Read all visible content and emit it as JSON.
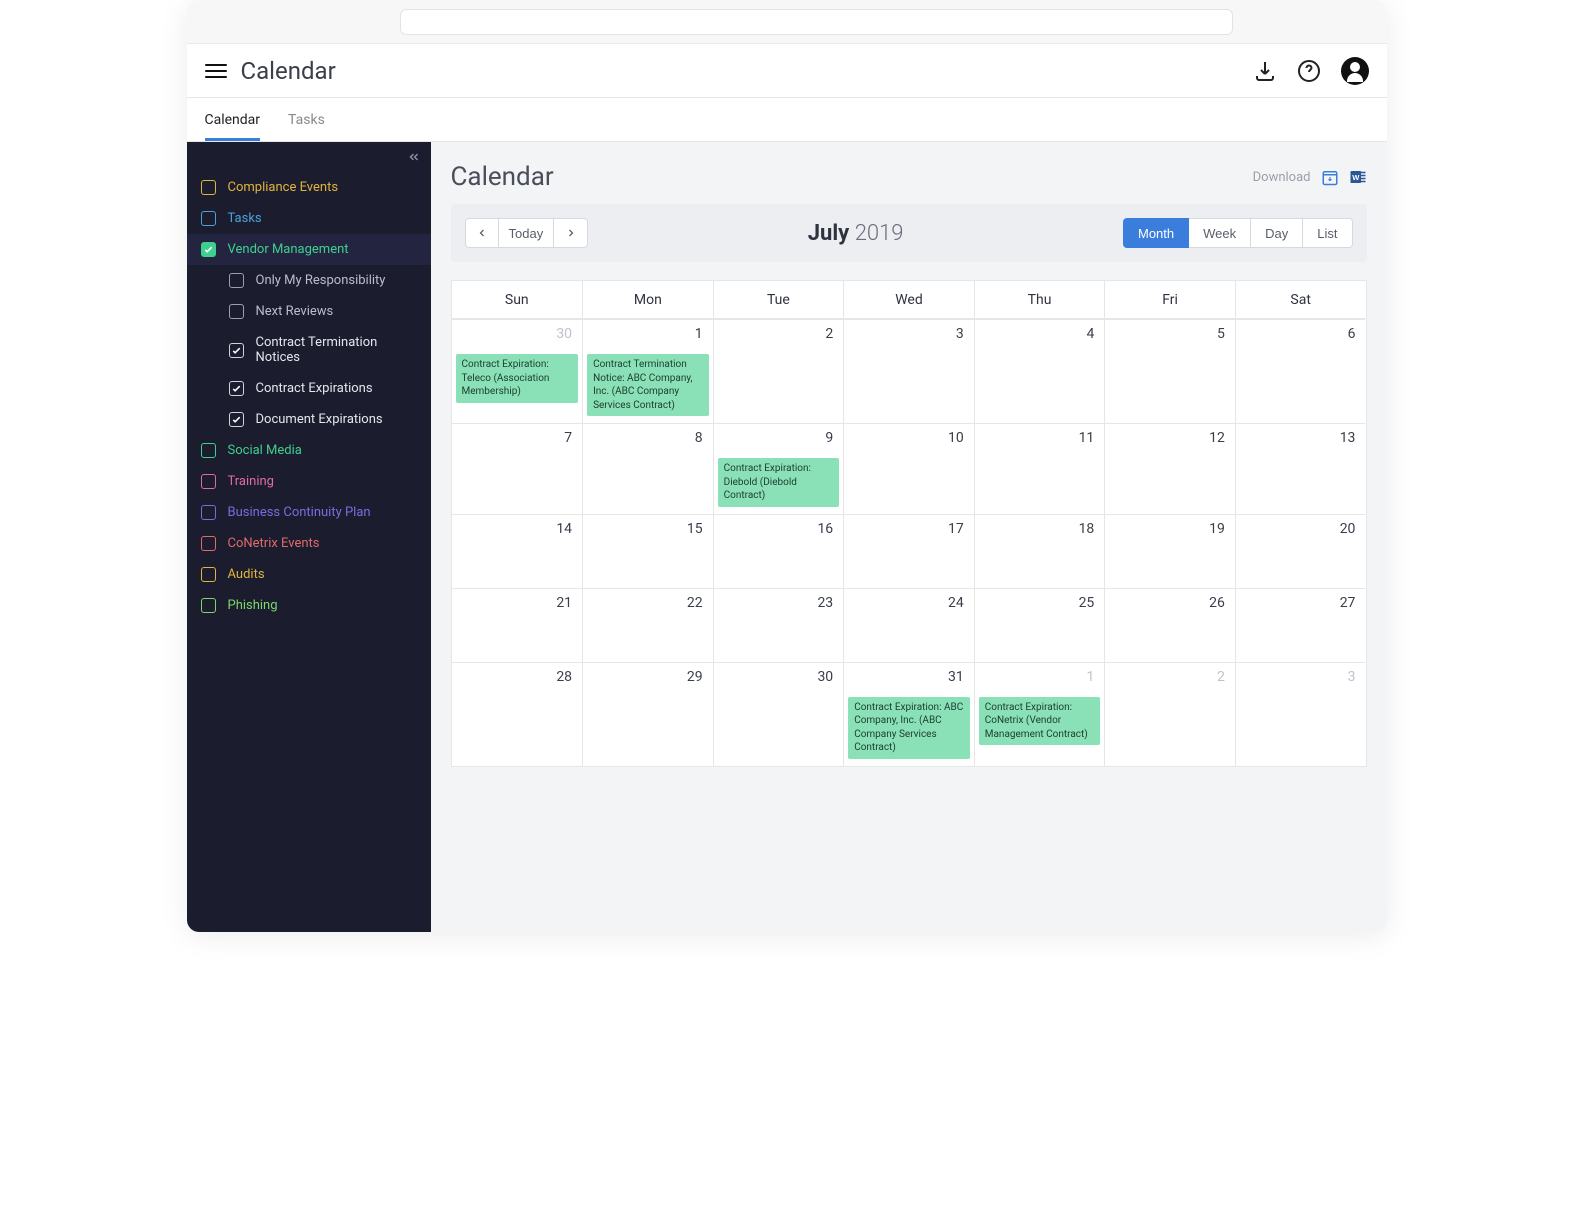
{
  "titlebar": {
    "dot_colors": [
      "#3fb3e5",
      "#3fb3e5",
      "#3fb3e5"
    ]
  },
  "header": {
    "title": "Calendar"
  },
  "tabs": [
    {
      "label": "Calendar",
      "active": true
    },
    {
      "label": "Tasks",
      "active": false
    }
  ],
  "sidebar": {
    "items": [
      {
        "label": "Compliance Events",
        "color": "#e2b33d",
        "checked": false
      },
      {
        "label": "Tasks",
        "color": "#4aa3df",
        "checked": false
      },
      {
        "label": "Vendor Management",
        "color": "#3fcf8e",
        "checked": true,
        "selected": true
      },
      {
        "label": "Only My Responsibility",
        "color": "#9aa0b4",
        "checked": false,
        "sub": true
      },
      {
        "label": "Next Reviews",
        "color": "#9aa0b4",
        "checked": false,
        "sub": true
      },
      {
        "label": "Contract Termination Notices",
        "color": "#cfd3e0",
        "checked": true,
        "sub": true
      },
      {
        "label": "Contract Expirations",
        "color": "#cfd3e0",
        "checked": true,
        "sub": true
      },
      {
        "label": "Document Expirations",
        "color": "#cfd3e0",
        "checked": true,
        "sub": true
      },
      {
        "label": "Social Media",
        "color": "#3fcf8e",
        "checked": false
      },
      {
        "label": "Training",
        "color": "#e06aa8",
        "checked": false
      },
      {
        "label": "Business Continuity Plan",
        "color": "#7a6be0",
        "checked": false
      },
      {
        "label": "CoNetrix Events",
        "color": "#e06a6a",
        "checked": false
      },
      {
        "label": "Audits",
        "color": "#e2b33d",
        "checked": false
      },
      {
        "label": "Phishing",
        "color": "#7fd66a",
        "checked": false
      }
    ]
  },
  "main": {
    "title": "Calendar",
    "download_label": "Download"
  },
  "toolbar": {
    "today_label": "Today",
    "month": "July",
    "year": "2019",
    "views": [
      {
        "label": "Month",
        "active": true
      },
      {
        "label": "Week",
        "active": false
      },
      {
        "label": "Day",
        "active": false
      },
      {
        "label": "List",
        "active": false
      }
    ]
  },
  "calendar": {
    "day_headers": [
      "Sun",
      "Mon",
      "Tue",
      "Wed",
      "Thu",
      "Fri",
      "Sat"
    ],
    "weeks": [
      {
        "days": [
          {
            "num": "30",
            "muted": true,
            "events": [
              "Contract Expiration: Teleco (Association Membership)"
            ]
          },
          {
            "num": "1",
            "events": [
              "Contract Termination Notice: ABC Company, Inc. (ABC Company Services Contract)"
            ]
          },
          {
            "num": "2"
          },
          {
            "num": "3"
          },
          {
            "num": "4"
          },
          {
            "num": "5"
          },
          {
            "num": "6"
          }
        ]
      },
      {
        "days": [
          {
            "num": "7"
          },
          {
            "num": "8"
          },
          {
            "num": "9",
            "events": [
              "Contract Expiration: Diebold (Diebold Contract)"
            ]
          },
          {
            "num": "10"
          },
          {
            "num": "11"
          },
          {
            "num": "12"
          },
          {
            "num": "13"
          }
        ]
      },
      {
        "days": [
          {
            "num": "14"
          },
          {
            "num": "15"
          },
          {
            "num": "16"
          },
          {
            "num": "17"
          },
          {
            "num": "18"
          },
          {
            "num": "19"
          },
          {
            "num": "20"
          }
        ]
      },
      {
        "days": [
          {
            "num": "21"
          },
          {
            "num": "22"
          },
          {
            "num": "23"
          },
          {
            "num": "24"
          },
          {
            "num": "25"
          },
          {
            "num": "26"
          },
          {
            "num": "27"
          }
        ]
      },
      {
        "days": [
          {
            "num": "28"
          },
          {
            "num": "29"
          },
          {
            "num": "30"
          },
          {
            "num": "31",
            "events": [
              "Contract Expiration: ABC Company, Inc. (ABC Company Services Contract)"
            ]
          },
          {
            "num": "1",
            "muted": true,
            "events": [
              "Contract Expiration: CoNetrix (Vendor Management Contract)"
            ]
          },
          {
            "num": "2",
            "muted": true
          },
          {
            "num": "3",
            "muted": true
          }
        ]
      }
    ]
  }
}
